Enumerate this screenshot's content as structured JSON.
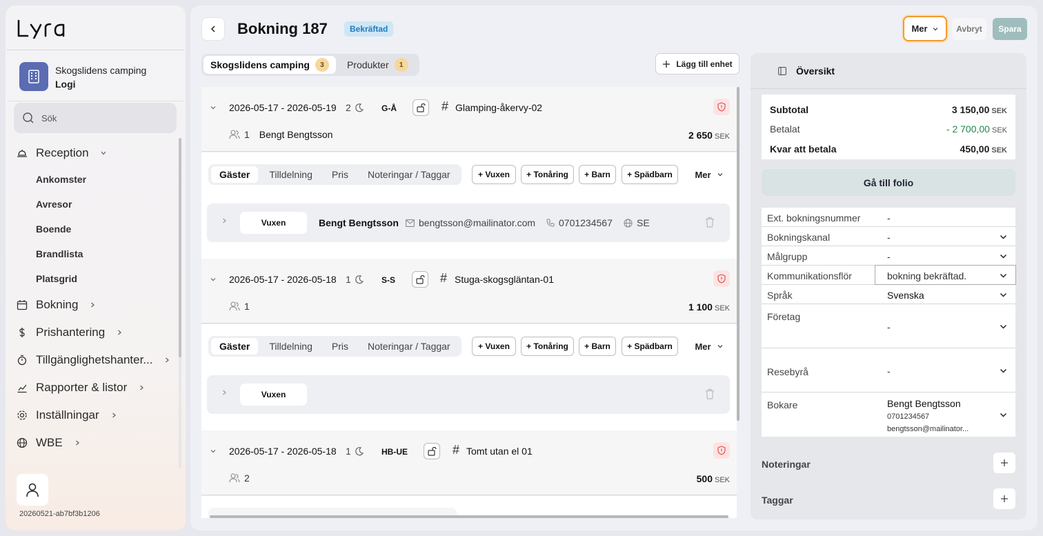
{
  "sidebar": {
    "logo": "Lyra",
    "org_name": "Skogslidens camping",
    "org_section": "Logi",
    "search_placeholder": "Sök",
    "nav": [
      {
        "label": "Reception",
        "icon": "bell-icon"
      },
      {
        "label": "Bokning",
        "icon": "calendar-icon"
      },
      {
        "label": "Prishantering",
        "icon": "dollar-icon"
      },
      {
        "label": "Tillgänglighetshanter...",
        "icon": "timer-icon"
      },
      {
        "label": "Rapporter & listor",
        "icon": "chart-icon"
      },
      {
        "label": "Inställningar",
        "icon": "gear-icon"
      },
      {
        "label": "WBE",
        "icon": "globe-icon"
      }
    ],
    "reception_sub": [
      "Ankomster",
      "Avresor",
      "Boende",
      "Brandlista",
      "Platsgrid"
    ],
    "build_id": "20260521-ab7bf3b1206"
  },
  "header": {
    "title": "Bokning 187",
    "status": "Bekräftad",
    "more_label": "Mer",
    "cancel_label": "Avbryt",
    "save_label": "Spara"
  },
  "tabs": [
    {
      "label": "Skogslidens camping",
      "count": "3"
    },
    {
      "label": "Produkter",
      "count": "1"
    }
  ],
  "add_unit_label": "Lägg till enhet",
  "units": [
    {
      "dates": "2026-05-17 - 2026-05-19",
      "nights": "2",
      "code": "G-Å",
      "name": "Glamping-åkervy-02",
      "guests": "1",
      "guest_name": "Bengt Bengtsson",
      "price": "2 650",
      "currency": "SEK"
    },
    {
      "dates": "2026-05-17 - 2026-05-18",
      "nights": "1",
      "code": "S-S",
      "name": "Stuga-skogsgläntan-01",
      "guests": "1",
      "guest_name": "",
      "price": "1 100",
      "currency": "SEK"
    },
    {
      "dates": "2026-05-17 - 2026-05-18",
      "nights": "1",
      "code": "HB-UE",
      "name": "Tomt utan el 01",
      "guests": "2",
      "guest_name": "",
      "price": "500",
      "currency": "SEK"
    }
  ],
  "subtabs": [
    "Gäster",
    "Tilldelning",
    "Pris",
    "Noteringar / Taggar"
  ],
  "add_buttons": [
    "+ Vuxen",
    "+ Tonåring",
    "+ Barn",
    "+ Spädbarn"
  ],
  "sub_more": "Mer",
  "guest_rows": [
    {
      "type": "Vuxen",
      "name": "Bengt Bengtsson",
      "email": "bengtsson@mailinator.com",
      "phone": "0701234567",
      "country": "SE"
    },
    {
      "type": "Vuxen",
      "name": "",
      "email": "",
      "phone": "",
      "country": ""
    }
  ],
  "overview": {
    "title": "Översikt",
    "subtotal_label": "Subtotal",
    "subtotal": "3 150,00",
    "paid_label": "Betalat",
    "paid": "- 2 700,00",
    "remaining_label": "Kvar att betala",
    "remaining": "450,00",
    "currency": "SEK",
    "folio_label": "Gå till folio",
    "fields": [
      {
        "label": "Ext. bokningsnummer",
        "value": "-"
      },
      {
        "label": "Bokningskanal",
        "value": "-"
      },
      {
        "label": "Målgrupp",
        "value": "-"
      },
      {
        "label": "Kommunikationsflöde",
        "value": "bokning bekräftad."
      },
      {
        "label": "Språk",
        "value": "Svenska"
      },
      {
        "label": "Företag",
        "value": "-"
      },
      {
        "label": "Resebyrå",
        "value": "-"
      },
      {
        "label": "Bokare",
        "value": "Bengt Bengtsson"
      }
    ],
    "field_label_comm_display": "Kommunikationsflör",
    "booker_phone": "0701234567",
    "booker_email": "bengtsson@mailinator...",
    "notes_label": "Noteringar",
    "tags_label": "Taggar"
  },
  "colors": {
    "accent": "#f39a2b",
    "status_badge": "#cfe6f5",
    "org_icon": "#5b6cb3",
    "paid_green": "#1e8a4a",
    "save_disabled": "#9fbdbd"
  }
}
